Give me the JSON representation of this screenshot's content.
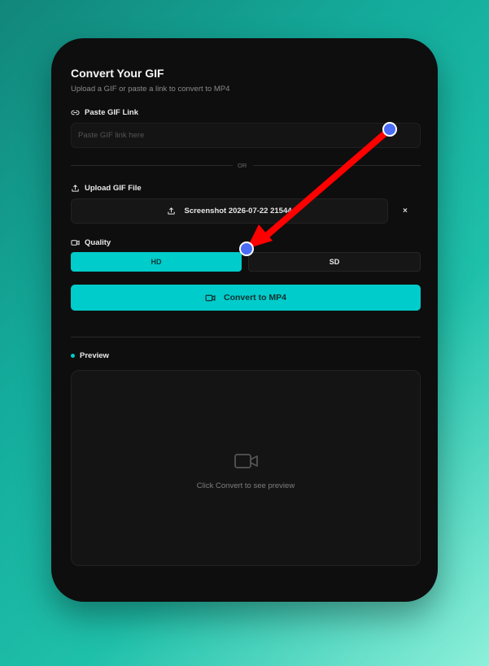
{
  "form": {
    "title": "Convert Your GIF",
    "subtitle": "Upload a GIF or paste a link to convert to MP4",
    "link_label": "Paste GIF Link",
    "link_placeholder": "Paste GIF link here",
    "or_text": "OR",
    "upload_label": "Upload GIF File",
    "file_name": "Screenshot 2026-07-22 21544",
    "clear_label": "×",
    "quality_label": "Quality",
    "quality_options": [
      "HD",
      "SD"
    ],
    "selected_quality": "HD",
    "convert_label": "Convert to MP4"
  },
  "preview": {
    "label": "Preview",
    "empty_text": "Click Convert to see preview"
  },
  "icons": {
    "link": "link-icon",
    "upload": "upload-icon",
    "quality": "video-icon",
    "convert": "video-icon",
    "preview": "video-camera-icon"
  },
  "colors": {
    "accent": "#00cccb",
    "card_bg": "#0e0e0e",
    "annotation_arrow": "#ff0000",
    "annotation_handle": "#4a6cf7"
  }
}
